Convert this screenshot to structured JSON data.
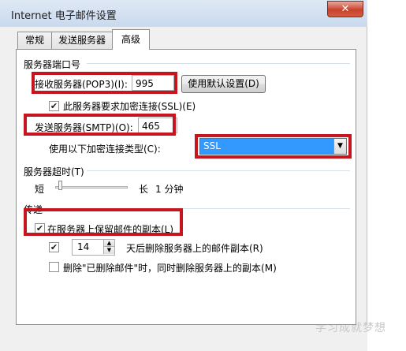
{
  "window": {
    "title": "Internet 电子邮件设置",
    "close_label": "✕"
  },
  "tabs": [
    {
      "label": "常规",
      "active": false
    },
    {
      "label": "发送服务器",
      "active": false
    },
    {
      "label": "高级",
      "active": true
    }
  ],
  "ports": {
    "group_label": "服务器端口号",
    "incoming_label": "接收服务器(POP3)(I):",
    "incoming_value": "995",
    "default_button": "使用默认设置(D)",
    "ssl_label": "此服务器要求加密连接(SSL)(E)",
    "ssl_checked": true,
    "outgoing_label": "发送服务器(SMTP)(O):",
    "outgoing_value": "465",
    "encryption_label": "使用以下加密连接类型(C):",
    "encryption_value": "SSL"
  },
  "timeout": {
    "group_label": "服务器超时(T)",
    "short_label": "短",
    "long_label": "长",
    "value": "1 分钟",
    "level": 0.05
  },
  "delivery": {
    "group_label": "传递",
    "keep_copy_label": "在服务器上保留邮件的副本(L)",
    "keep_copy_checked": true,
    "remove_after_checked": true,
    "days_value": "14",
    "remove_after_label": "天后删除服务器上的邮件副本(R)",
    "remove_deleted_label": "删除\"已删除邮件\"时，同时删除服务器上的副本(M)",
    "remove_deleted_checked": false
  },
  "icons": {
    "close": "close-icon",
    "dropdown": "chevron-down-icon",
    "spin_up": "spin-up-icon",
    "spin_down": "spin-down-icon"
  },
  "colors": {
    "highlight": "#c4161c",
    "selection": "#3399ff"
  }
}
